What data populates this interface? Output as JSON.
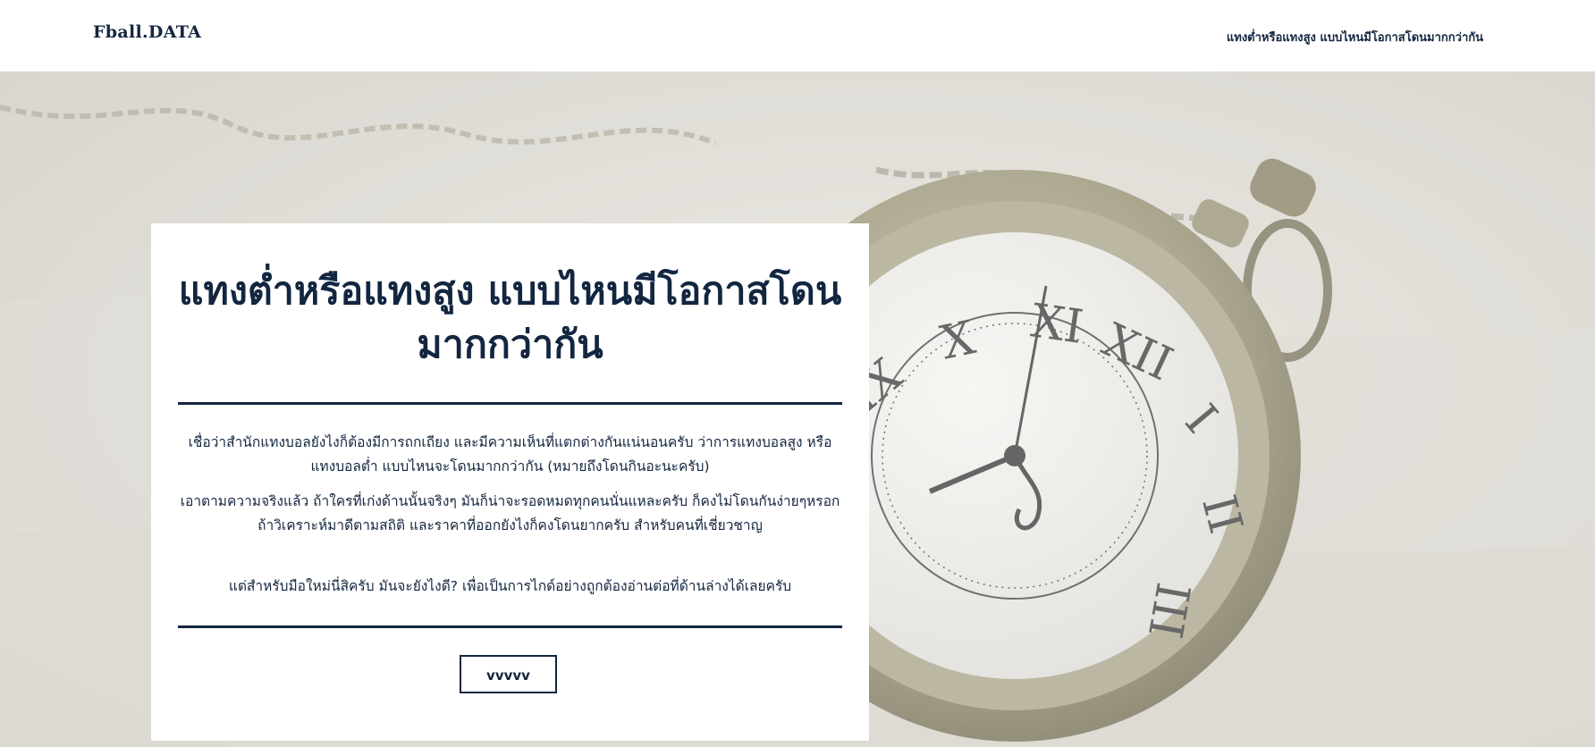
{
  "header": {
    "brand": "Fball.DATA",
    "nav_link": "แทงต่ำหรือแทงสูง แบบไหนมีโอกาสโดนมากกว่ากัน"
  },
  "hero": {
    "background_image": "pocket-watch-in-sand",
    "clock_numerals": [
      "X",
      "XI",
      "XII",
      "I",
      "II",
      "III",
      "IX"
    ]
  },
  "card": {
    "title": "แทงต่ำหรือแทงสูง แบบไหนมีโอกาสโดนมากกว่ากัน",
    "paragraph1": "เชื่อว่าสำนักแทงบอลยังไงก็ต้องมีการถกเถียง และมีความเห็นที่แตกต่างกันแน่นอนครับ ว่าการแทงบอลสูง หรือแทงบอลต่ำ แบบไหนจะโดนมากกว่ากัน (หมายถึงโดนกินอะนะครับ)",
    "paragraph2": "เอาตามความจริงแล้ว ถ้าใครที่เก่งด้านนั้นจริงๆ มันก็น่าจะรอดหมดทุกคนนั่นแหละครับ ก็คงไม่โดนกันง่ายๆหรอก ถ้าวิเคราะห์มาดีตามสถิติ และราคาที่ออกยังไงก็คงโดนยากครับ สำหรับคนที่เชี่ยวชาญ",
    "paragraph3": "แต่สำหรับมือใหม่นี่สิครับ มันจะยังไงดี? เพื่อเป็นการไกด์อย่างถูกต้องอ่านต่อที่ด้านล่างได้เลยครับ",
    "button_label": "vvvvv"
  },
  "colors": {
    "navy": "#132640",
    "white": "#ffffff",
    "sand": "#d8d5cd"
  }
}
